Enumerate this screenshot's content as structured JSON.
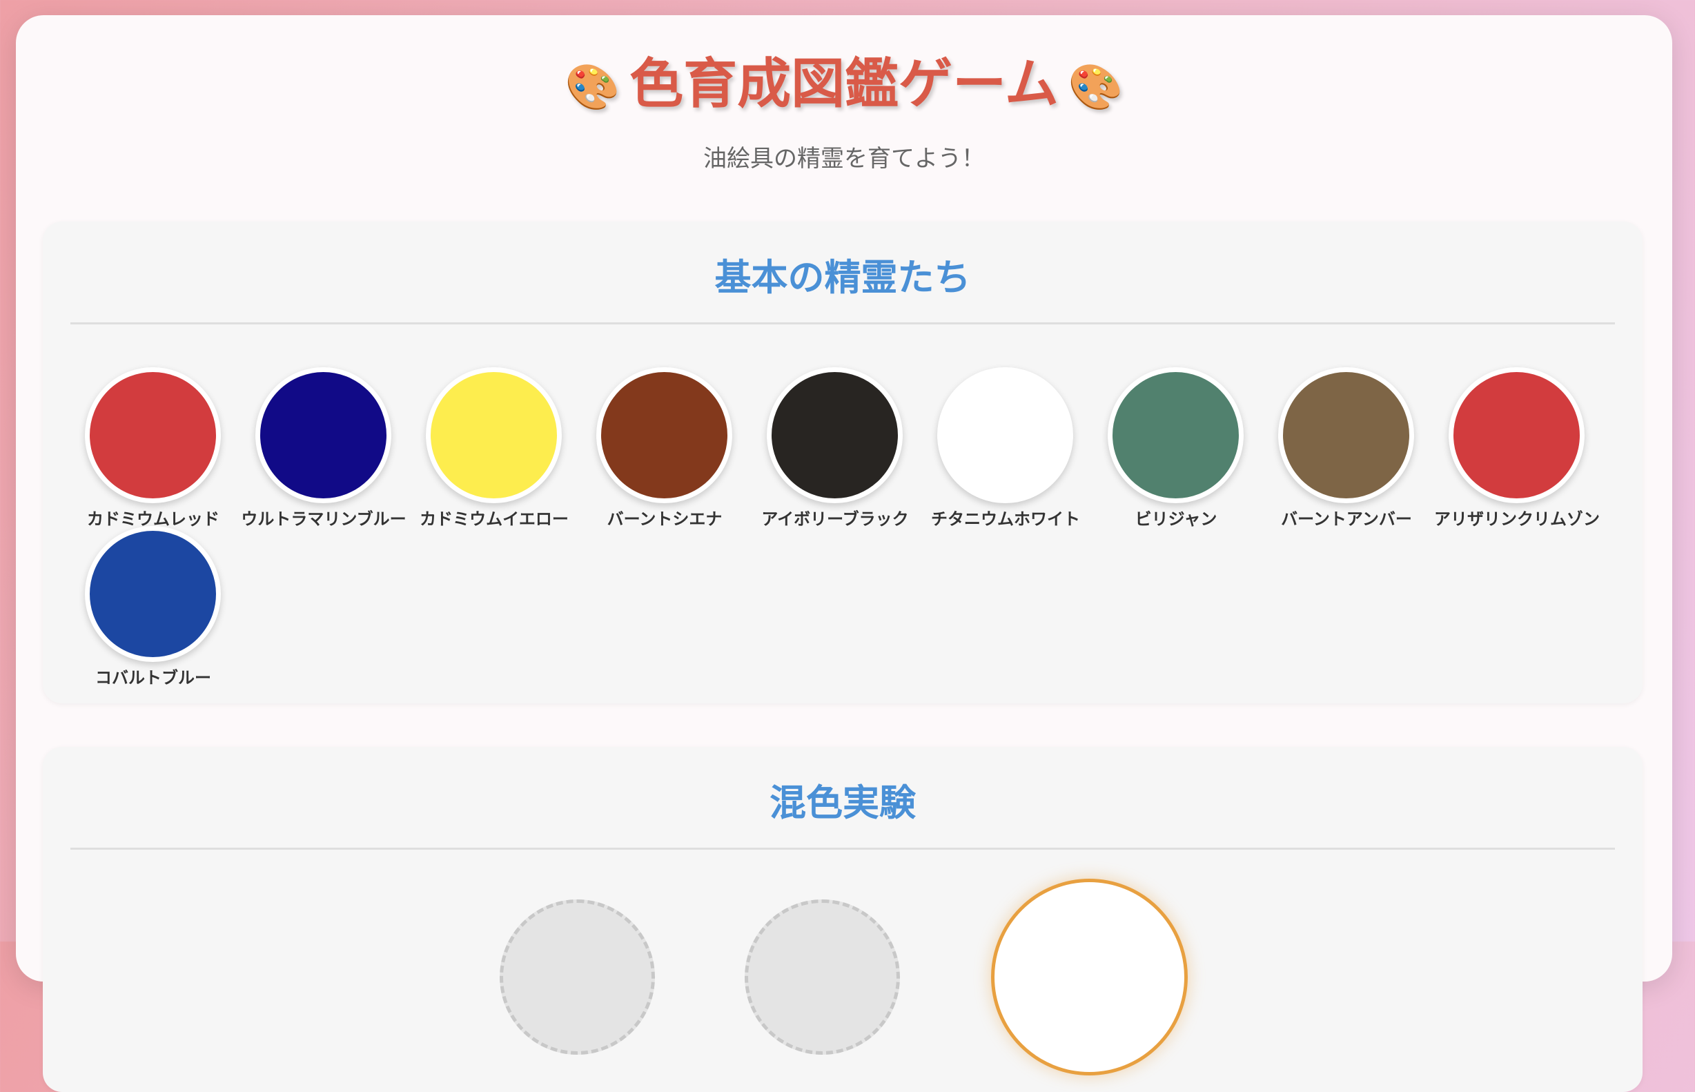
{
  "header": {
    "title": "色育成図鑑ゲーム",
    "title_icon": "palette-icon",
    "title_icon_glyph": "🎨",
    "subtitle": "油絵具の精霊を育てよう！"
  },
  "basic_section": {
    "heading": "基本の精霊たち",
    "spirits": [
      {
        "name": "カドミウムレッド",
        "color": "#d23c3e"
      },
      {
        "name": "ウルトラマリンブルー",
        "color": "#110a87"
      },
      {
        "name": "カドミウムイエロー",
        "color": "#fded4e"
      },
      {
        "name": "バーントシエナ",
        "color": "#83391c"
      },
      {
        "name": "アイボリーブラック",
        "color": "#282522"
      },
      {
        "name": "チタニウムホワイト",
        "color": "#ffffff"
      },
      {
        "name": "ビリジャン",
        "color": "#51816e"
      },
      {
        "name": "バーントアンバー",
        "color": "#7e6546"
      },
      {
        "name": "アリザリンクリムゾン",
        "color": "#d23c3e"
      },
      {
        "name": "コバルトブルー",
        "color": "#1c47a2"
      }
    ]
  },
  "mix_section": {
    "heading": "混色実験",
    "result_border_color": "#e8a040"
  }
}
